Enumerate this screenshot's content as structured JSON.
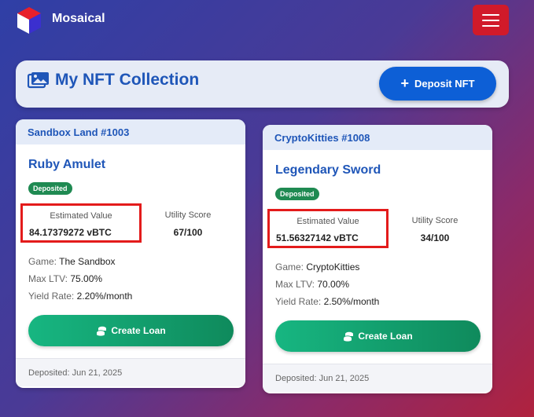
{
  "app": {
    "name": "Mosaical"
  },
  "header": {
    "title": "My NFT Collection",
    "deposit_button": "Deposit NFT"
  },
  "cards": [
    {
      "collection": "Sandbox Land #1003",
      "name": "Ruby Amulet",
      "status": "Deposited",
      "estimated_label": "Estimated Value",
      "estimated_value": "84.17379272 vBTC",
      "utility_label": "Utility Score",
      "utility_value": "67/100",
      "game_label": "Game:",
      "game": "The Sandbox",
      "ltv_label": "Max LTV:",
      "ltv": "75.00%",
      "yield_label": "Yield Rate:",
      "yield": "2.20%/month",
      "loan_button": "Create Loan",
      "deposited_date": "Deposited: Jun 21, 2025"
    },
    {
      "collection": "CryptoKitties #1008",
      "name": "Legendary Sword",
      "status": "Deposited",
      "estimated_label": "Estimated Value",
      "estimated_value": "51.56327142 vBTC",
      "utility_label": "Utility Score",
      "utility_value": "34/100",
      "game_label": "Game:",
      "game": "CryptoKitties",
      "ltv_label": "Max LTV:",
      "ltv": "70.00%",
      "yield_label": "Yield Rate:",
      "yield": "2.50%/month",
      "loan_button": "Create Loan",
      "deposited_date": "Deposited: Jun 21, 2025"
    }
  ],
  "colors": {
    "accent": "#1f56b8",
    "primary_button": "#0d5fd6",
    "menu_button": "#d11a2a",
    "success": "#1f8a52",
    "highlight_border": "#e31b1b"
  },
  "icons": {
    "logo": "cube-logo-icon",
    "menu": "hamburger-menu-icon",
    "collection": "images-icon",
    "deposit": "plus-icon",
    "loan": "coins-icon"
  }
}
